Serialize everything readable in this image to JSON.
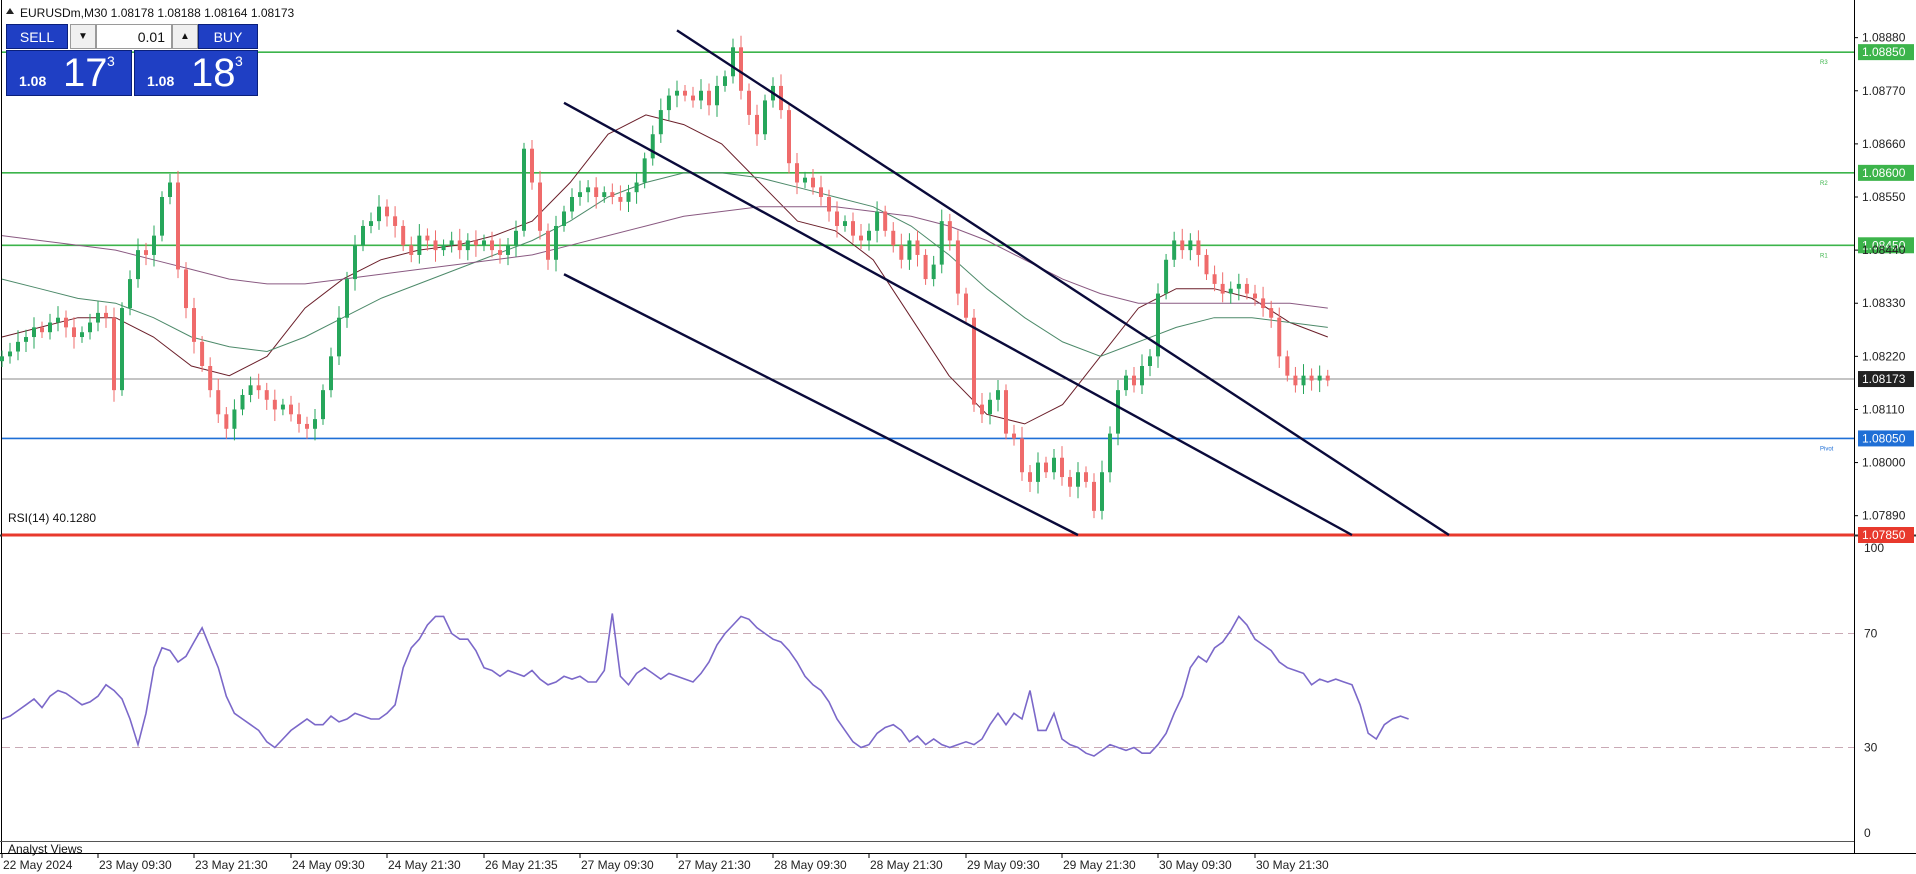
{
  "header": {
    "symbol_line": "EURUSDm,M30  1.08178 1.08188 1.08164 1.08173"
  },
  "trade_panel": {
    "sell_label": "SELL",
    "buy_label": "BUY",
    "lot": "0.01",
    "sell_prefix": "1.08",
    "sell_big": "17",
    "sell_sup": "3",
    "buy_prefix": "1.08",
    "buy_big": "18",
    "buy_sup": "3"
  },
  "bottom_tab": "Analyst Views",
  "colors": {
    "bull": "#26a65b",
    "bear": "#ef6b6b",
    "level_green": "#3cb44b",
    "pivot_blue": "#1f6fd6",
    "support_red": "#e8392d",
    "channel": "#0a0a3a",
    "rsi": "#7b68c9",
    "ma_dark": "#6b1f2a",
    "ma_mid": "#4d8a6a",
    "ma_slow": "#8a5a82"
  },
  "chart_data": [
    {
      "type": "candlestick",
      "symbol": "EURUSDm",
      "timeframe": "M30",
      "ohlc_last": {
        "open": 1.08178,
        "high": 1.08188,
        "low": 1.08164,
        "close": 1.08173
      },
      "ylim": [
        1.0785,
        1.089
      ],
      "y_ticks": [
        "1.08880",
        "1.08770",
        "1.08660",
        "1.08550",
        "1.08440",
        "1.08330",
        "1.08220",
        "1.08110",
        "1.08000",
        "1.07890"
      ],
      "x_ticks": [
        "22 May 2024",
        "23 May 09:30",
        "23 May 21:30",
        "24 May 09:30",
        "24 May 21:30",
        "26 May 21:35",
        "27 May 09:30",
        "27 May 21:30",
        "28 May 09:30",
        "28 May 21:30",
        "29 May 09:30",
        "29 May 21:30",
        "30 May 09:30",
        "30 May 21:30"
      ],
      "current_price": "1.08173",
      "levels": [
        {
          "label": "R3",
          "tag": "1.08850",
          "value": 1.0885,
          "kind": "resistance"
        },
        {
          "label": "R2",
          "tag": "1.08600",
          "value": 1.086,
          "kind": "resistance"
        },
        {
          "label": "R1",
          "tag": "1.08450",
          "value": 1.0845,
          "kind": "resistance"
        },
        {
          "label": "Pivot",
          "tag": "1.08050",
          "value": 1.0805,
          "kind": "pivot"
        },
        {
          "label": "",
          "tag": "1.07850",
          "value": 1.0785,
          "kind": "support"
        }
      ],
      "channel_lines": [
        {
          "from": [
            "27 May 21:30",
            1.08895
          ],
          "to": [
            "31 May 12:00",
            1.0785
          ]
        },
        {
          "from": [
            "27 May 00:00",
            1.08745
          ],
          "to": [
            "31 May 04:00",
            1.0785
          ]
        },
        {
          "from": [
            "27 May 00:00",
            1.0839
          ],
          "to": [
            "29 May 23:00",
            1.0785
          ]
        }
      ],
      "close_path": [
        1.0822,
        1.0823,
        1.0825,
        1.0826,
        1.0828,
        1.0827,
        1.0829,
        1.083,
        1.0828,
        1.0826,
        1.0827,
        1.0829,
        1.0831,
        1.083,
        1.0815,
        1.0832,
        1.0838,
        1.0844,
        1.0843,
        1.0847,
        1.0855,
        1.0858,
        1.084,
        1.0832,
        1.0825,
        1.082,
        1.0815,
        1.081,
        1.0807,
        1.0811,
        1.0814,
        1.0816,
        1.0815,
        1.0813,
        1.0811,
        1.0812,
        1.081,
        1.0808,
        1.0807,
        1.0809,
        1.0815,
        1.0822,
        1.083,
        1.0838,
        1.0845,
        1.0849,
        1.085,
        1.0853,
        1.0851,
        1.0849,
        1.0845,
        1.0843,
        1.0847,
        1.0846,
        1.0844,
        1.0845,
        1.0846,
        1.0844,
        1.0846,
        1.0845,
        1.0846,
        1.0844,
        1.0843,
        1.0845,
        1.0848,
        1.0865,
        1.0858,
        1.0848,
        1.0842,
        1.0849,
        1.0852,
        1.0855,
        1.0856,
        1.0857,
        1.0855,
        1.0856,
        1.0855,
        1.0854,
        1.0856,
        1.0858,
        1.0863,
        1.0868,
        1.0873,
        1.0876,
        1.0877,
        1.0876,
        1.0875,
        1.0877,
        1.0874,
        1.0878,
        1.088,
        1.0886,
        1.0877,
        1.0872,
        1.0868,
        1.0875,
        1.0878,
        1.0873,
        1.0862,
        1.0858,
        1.0859,
        1.0857,
        1.0855,
        1.0852,
        1.0849,
        1.085,
        1.0847,
        1.0846,
        1.0848,
        1.0852,
        1.0848,
        1.0845,
        1.0842,
        1.0846,
        1.0843,
        1.0838,
        1.0841,
        1.085,
        1.0846,
        1.0835,
        1.083,
        1.0812,
        1.081,
        1.0813,
        1.0815,
        1.0806,
        1.0805,
        1.0798,
        1.0796,
        1.08,
        1.0798,
        1.0801,
        1.0797,
        1.0795,
        1.0798,
        1.0796,
        1.079,
        1.0798,
        1.0806,
        1.0815,
        1.0818,
        1.0816,
        1.082,
        1.0822,
        1.0835,
        1.0842,
        1.0846,
        1.0844,
        1.0846,
        1.0843,
        1.0839,
        1.0837,
        1.0835,
        1.0836,
        1.0837,
        1.0835,
        1.0834,
        1.0832,
        1.083,
        1.0822,
        1.0818,
        1.0816,
        1.0818,
        1.0817,
        1.0818,
        1.0817
      ],
      "moving_averages": [
        {
          "color_key": "ma_dark",
          "path": [
            1.0826,
            1.0828,
            1.083,
            1.083,
            1.0826,
            1.082,
            1.0818,
            1.0822,
            1.0832,
            1.0838,
            1.0842,
            1.0844,
            1.0845,
            1.0847,
            1.085,
            1.0858,
            1.0868,
            1.0872,
            1.087,
            1.0866,
            1.0858,
            1.085,
            1.0848,
            1.0842,
            1.083,
            1.0818,
            1.081,
            1.0808,
            1.0812,
            1.0822,
            1.0832,
            1.0836,
            1.0836,
            1.0834,
            1.0829,
            1.0826
          ]
        },
        {
          "color_key": "ma_mid",
          "path": [
            1.0838,
            1.0836,
            1.0834,
            1.0833,
            1.083,
            1.0826,
            1.0824,
            1.0823,
            1.0826,
            1.083,
            1.0834,
            1.0837,
            1.084,
            1.0843,
            1.0846,
            1.085,
            1.0855,
            1.0858,
            1.086,
            1.086,
            1.0859,
            1.0857,
            1.0855,
            1.0853,
            1.0849,
            1.0843,
            1.0836,
            1.083,
            1.0825,
            1.0822,
            1.0825,
            1.0828,
            1.083,
            1.083,
            1.0829,
            1.0828
          ]
        },
        {
          "color_key": "ma_slow",
          "path": [
            1.0847,
            1.0846,
            1.0845,
            1.0844,
            1.0842,
            1.084,
            1.0838,
            1.0837,
            1.0837,
            1.0838,
            1.0839,
            1.084,
            1.0841,
            1.0842,
            1.0843,
            1.0845,
            1.0847,
            1.0849,
            1.0851,
            1.0852,
            1.0853,
            1.0853,
            1.0853,
            1.0852,
            1.0851,
            1.0849,
            1.0846,
            1.0842,
            1.0838,
            1.0835,
            1.0833,
            1.0833,
            1.0833,
            1.0833,
            1.0833,
            1.0832
          ]
        }
      ]
    },
    {
      "type": "line",
      "title": "RSI(14) 40.1280",
      "ylim": [
        0,
        100
      ],
      "y_ticks": [
        "100",
        "70",
        "30",
        "0"
      ],
      "reference_levels": [
        70,
        30
      ],
      "values": [
        40,
        41,
        43,
        45,
        47,
        44,
        48,
        50,
        49,
        47,
        45,
        46,
        48,
        52,
        50,
        47,
        40,
        31,
        42,
        58,
        65,
        64,
        60,
        62,
        67,
        72,
        65,
        58,
        48,
        42,
        40,
        38,
        36,
        32,
        30,
        33,
        36,
        38,
        40,
        38,
        38,
        41,
        39,
        40,
        42,
        41,
        40,
        40,
        42,
        45,
        58,
        65,
        68,
        73,
        76,
        76,
        70,
        68,
        68,
        64,
        58,
        57,
        55,
        57,
        56,
        55,
        57,
        54,
        52,
        53,
        55,
        54,
        55,
        53,
        53,
        57,
        77,
        55,
        52,
        56,
        58,
        56,
        54,
        56,
        55,
        54,
        53,
        56,
        60,
        66,
        70,
        73,
        76,
        75,
        72,
        70,
        68,
        67,
        64,
        60,
        55,
        52,
        50,
        46,
        40,
        36,
        32,
        30,
        31,
        35,
        37,
        38,
        36,
        32,
        34,
        31,
        33,
        31,
        30,
        31,
        32,
        31,
        33,
        38,
        42,
        38,
        42,
        40,
        50,
        36,
        36,
        42,
        33,
        31,
        30,
        28,
        27,
        29,
        31,
        30,
        29,
        30,
        28,
        28,
        31,
        35,
        42,
        48,
        58,
        62,
        60,
        65,
        67,
        71,
        76,
        73,
        68,
        66,
        64,
        60,
        58,
        57,
        56,
        52,
        54,
        53,
        54,
        53,
        52,
        45,
        35,
        33,
        38,
        40,
        41,
        40
      ]
    }
  ]
}
